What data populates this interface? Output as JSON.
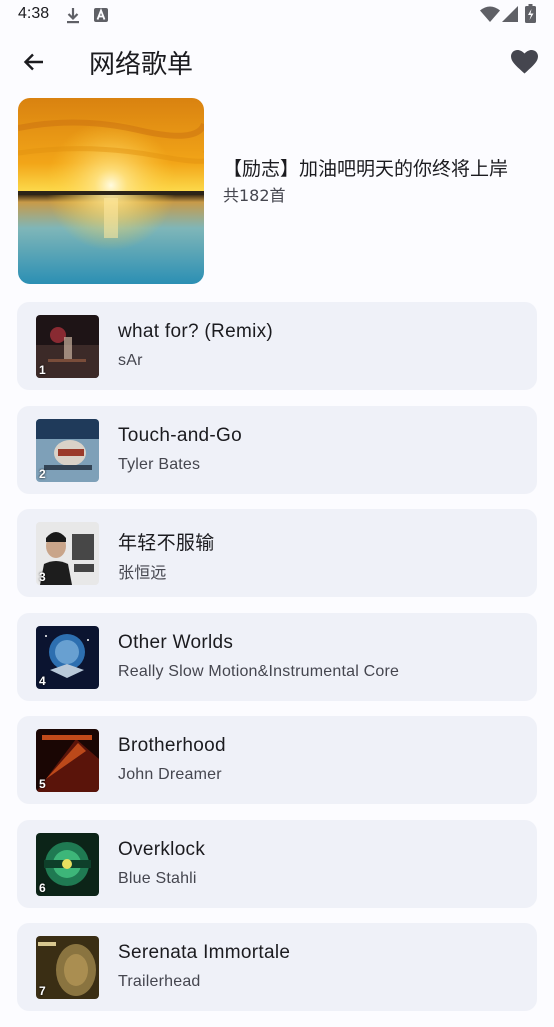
{
  "status_bar": {
    "time": "4:38",
    "icons": [
      "download-icon",
      "a-icon",
      "wifi-icon",
      "signal-icon",
      "battery-icon"
    ]
  },
  "app_bar": {
    "title": "网络歌单",
    "back_icon": "arrow-left-icon",
    "favorite_icon": "heart-icon"
  },
  "playlist": {
    "name": "【励志】加油吧明天的你终将上岸",
    "count_label": "共182首"
  },
  "songs": [
    {
      "index": "1",
      "title": "what for? (Remix)",
      "artist": "sAr"
    },
    {
      "index": "2",
      "title": "Touch-and-Go",
      "artist": "Tyler Bates"
    },
    {
      "index": "3",
      "title": "年轻不服输",
      "artist": "张恒远"
    },
    {
      "index": "4",
      "title": "Other Worlds",
      "artist": "Really Slow Motion&Instrumental Core"
    },
    {
      "index": "5",
      "title": "Brotherhood",
      "artist": "John Dreamer"
    },
    {
      "index": "6",
      "title": "Overklock",
      "artist": "Blue Stahli"
    },
    {
      "index": "7",
      "title": "Serenata Immortale",
      "artist": "Trailerhead"
    }
  ],
  "colors": {
    "background": "#fcfcff",
    "card": "#eff1f8",
    "text_primary": "#1b1b1f",
    "text_secondary": "#45464f"
  }
}
